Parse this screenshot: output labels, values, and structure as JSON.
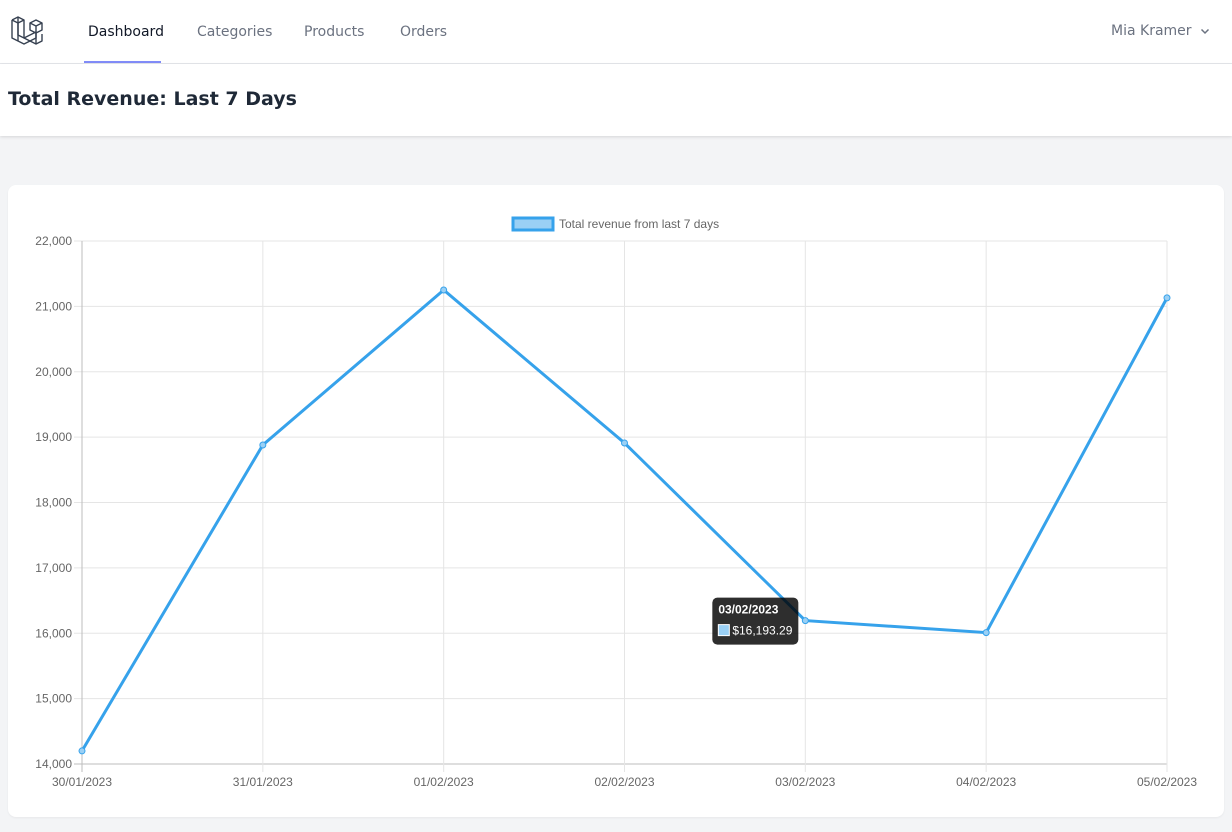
{
  "nav": {
    "items": [
      {
        "label": "Dashboard",
        "active": true
      },
      {
        "label": "Categories",
        "active": false
      },
      {
        "label": "Products",
        "active": false
      },
      {
        "label": "Orders",
        "active": false
      }
    ],
    "user_name": "Mia Kramer"
  },
  "header": {
    "title": "Total Revenue: Last 7 Days"
  },
  "colors": {
    "line": "#36a2eb",
    "fill": "#9ad0f5",
    "accent_underline": "#818cf8"
  },
  "chart_data": {
    "type": "line",
    "categories": [
      "30/01/2023",
      "31/01/2023",
      "01/02/2023",
      "02/02/2023",
      "03/02/2023",
      "04/02/2023",
      "05/02/2023"
    ],
    "series": [
      {
        "name": "Total revenue from last 7 days",
        "values": [
          14200,
          18880,
          21250,
          18910,
          16193.29,
          16010,
          21130
        ]
      }
    ],
    "ylim": [
      14000,
      22000
    ],
    "yticks": [
      14000,
      15000,
      16000,
      17000,
      18000,
      19000,
      20000,
      21000,
      22000
    ],
    "ytick_labels": [
      "14,000",
      "15,000",
      "16,000",
      "17,000",
      "18,000",
      "19,000",
      "20,000",
      "21,000",
      "22,000"
    ],
    "grid": true,
    "legend": "top-center",
    "tooltip": {
      "title": "03/02/2023",
      "value": "$16,193.29"
    }
  }
}
